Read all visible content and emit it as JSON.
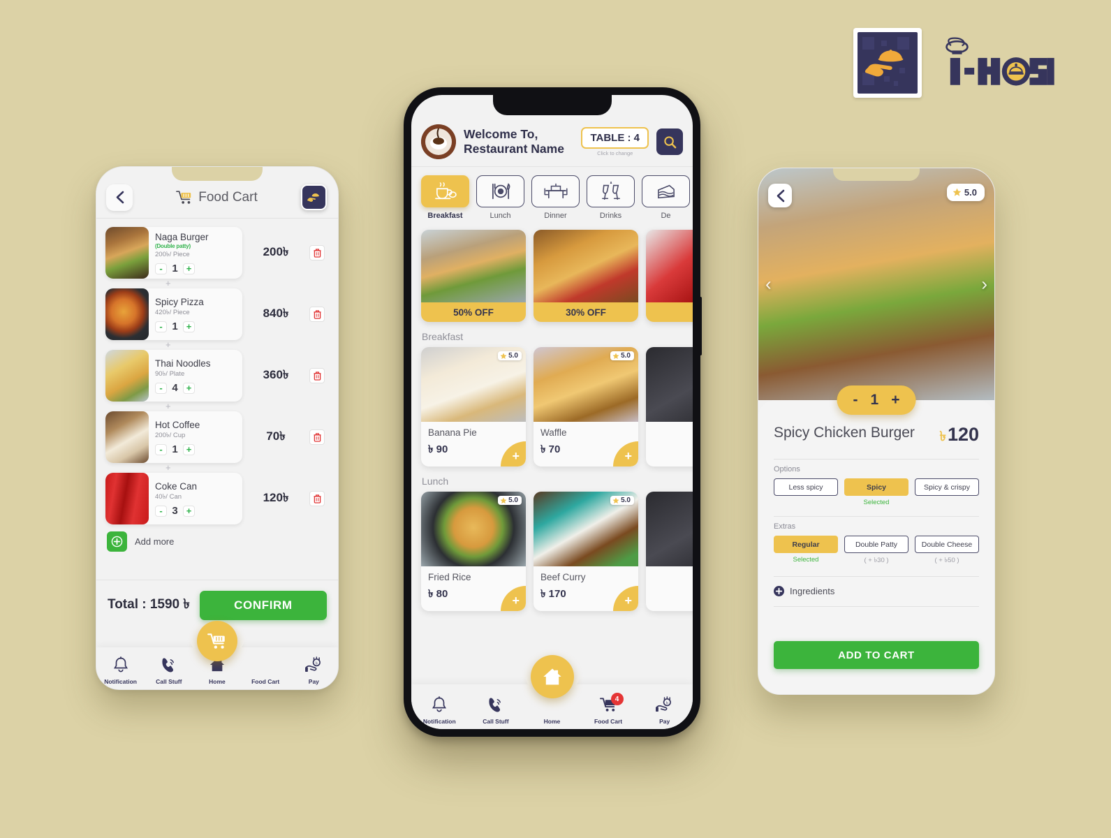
{
  "brand": {
    "name": "I-HOST",
    "colors": {
      "navy": "#36355c",
      "yellow": "#eec24e",
      "green": "#3cb43c",
      "background": "#dcd2a6"
    }
  },
  "phone1": {
    "header": {
      "title": "Food Cart",
      "back_label": "‹"
    },
    "items": [
      {
        "name": "Naga Burger",
        "variant": "(Double patty)",
        "unit": "200৳/ Piece",
        "qty": "1",
        "total": "200৳",
        "photo": "ph-burger"
      },
      {
        "name": "Spicy Pizza",
        "variant": "",
        "unit": "420৳/ Piece",
        "qty": "1",
        "total": "840৳",
        "photo": "ph-pizza"
      },
      {
        "name": "Thai Noodles",
        "variant": "",
        "unit": "90৳/ Plate",
        "qty": "4",
        "total": "360৳",
        "photo": "ph-noodles"
      },
      {
        "name": "Hot Coffee",
        "variant": "",
        "unit": "200৳/ Cup",
        "qty": "1",
        "total": "70৳",
        "photo": "ph-coffee"
      },
      {
        "name": "Coke Can",
        "variant": "",
        "unit": "40৳/ Can",
        "qty": "3",
        "total": "120৳",
        "photo": "ph-coke"
      }
    ],
    "add_more": "Add more",
    "total_label": "Total : 1590 ৳",
    "confirm_label": "CONFIRM",
    "nav": [
      {
        "label": "Notification",
        "icon": "bell-icon"
      },
      {
        "label": "Call Stuff",
        "icon": "phone-ring-icon"
      },
      {
        "label": "Home",
        "icon": "home-icon"
      },
      {
        "label": "Food Cart",
        "icon": "cart-icon"
      },
      {
        "label": "Pay",
        "icon": "hand-coin-icon"
      }
    ]
  },
  "phone2": {
    "welcome_line1": "Welcome To,",
    "welcome_line2": "Restaurant Name",
    "table_label": "TABLE : 4",
    "table_hint": "Click to change",
    "categories": [
      {
        "label": "Breakfast",
        "icon": "teacup-icon",
        "active": true
      },
      {
        "label": "Lunch",
        "icon": "plate-cutlery-icon",
        "active": false
      },
      {
        "label": "Dinner",
        "icon": "dining-table-icon",
        "active": false
      },
      {
        "label": "Drinks",
        "icon": "cheers-glasses-icon",
        "active": false
      },
      {
        "label": "De",
        "icon": "cake-slice-icon",
        "active": false
      }
    ],
    "banners": [
      {
        "tag": "50% OFF",
        "photo": "ph-gourmet"
      },
      {
        "tag": "30% OFF",
        "photo": "ph-fried"
      },
      {
        "tag": "",
        "photo": "ph-red"
      }
    ],
    "sections": [
      {
        "title": "Breakfast",
        "items": [
          {
            "name": "Banana Pie",
            "price": "৳ 90",
            "rating": "5.0",
            "photo": "ph-pie"
          },
          {
            "name": "Waffle",
            "price": "৳ 70",
            "rating": "5.0",
            "photo": "ph-waffle"
          },
          {
            "name": "",
            "price": "",
            "rating": "",
            "photo": "ph-dark"
          }
        ]
      },
      {
        "title": "Lunch",
        "items": [
          {
            "name": "Fried Rice",
            "price": "৳ 80",
            "rating": "5.0",
            "photo": "ph-rice"
          },
          {
            "name": "Beef Curry",
            "price": "৳ 170",
            "rating": "5.0",
            "photo": "ph-curry"
          },
          {
            "name": "",
            "price": "",
            "rating": "",
            "photo": "ph-dark"
          }
        ]
      }
    ],
    "nav": [
      {
        "label": "Notification",
        "icon": "bell-icon",
        "badge": ""
      },
      {
        "label": "Call Stuff",
        "icon": "phone-ring-icon",
        "badge": ""
      },
      {
        "label": "Home",
        "icon": "home-icon",
        "badge": ""
      },
      {
        "label": "Food Cart",
        "icon": "cart-icon",
        "badge": "4"
      },
      {
        "label": "Pay",
        "icon": "hand-coin-icon",
        "badge": ""
      }
    ]
  },
  "phone3": {
    "rating": "5.0",
    "qty": "1",
    "name": "Spicy Chicken Burger",
    "currency": "৳",
    "price": "120",
    "options_label": "Options",
    "options": [
      {
        "label": "Less spicy",
        "note": "",
        "selected": false
      },
      {
        "label": "Spicy",
        "note": "Selected",
        "selected": true
      },
      {
        "label": "Spicy & crispy",
        "note": "",
        "selected": false
      }
    ],
    "extras_label": "Extras",
    "extras": [
      {
        "label": "Regular",
        "note": "Selected",
        "selected": true
      },
      {
        "label": "Double Patty",
        "note": "( + ৳30 )",
        "selected": false
      },
      {
        "label": "Double Cheese",
        "note": "( + ৳50 )",
        "selected": false
      }
    ],
    "ingredients_label": "Ingredients",
    "add_to_cart": "ADD TO CART"
  }
}
